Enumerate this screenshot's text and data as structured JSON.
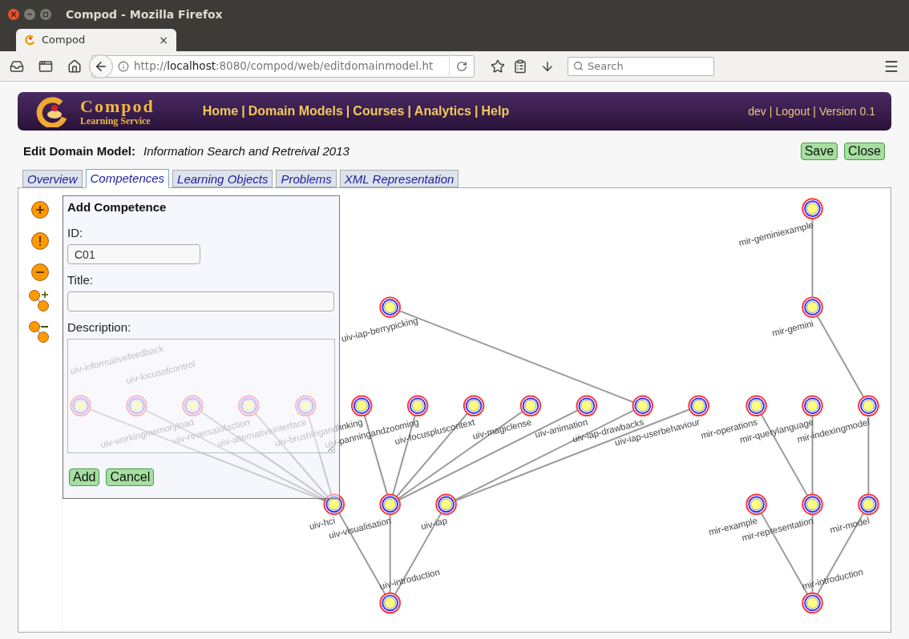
{
  "browser": {
    "window_title": "Compod - Mozilla Firefox",
    "tab": {
      "label": "Compod",
      "close": "×"
    },
    "url": {
      "scheme": "http://",
      "host": "localhost",
      "rest": ":8080/compod/web/editdomainmodel.ht"
    },
    "search": {
      "placeholder": "Search"
    }
  },
  "header": {
    "logo_title": "Compod",
    "logo_subtitle": "Learning Service",
    "separator": "|",
    "nav": [
      "Home",
      "Domain Models",
      "Courses",
      "Analytics",
      "Help"
    ],
    "account": [
      "dev",
      "Logout",
      "Version 0.1"
    ]
  },
  "edit": {
    "label": "Edit Domain Model:",
    "name": "Information Search and Retreival 2013",
    "buttons": [
      "Save",
      "Close"
    ]
  },
  "tabs": [
    {
      "label": "Overview",
      "selected": false
    },
    {
      "label": "Competences",
      "selected": true
    },
    {
      "label": "Learning Objects",
      "selected": false
    },
    {
      "label": "Problems",
      "selected": false
    },
    {
      "label": "XML Representation",
      "selected": false
    }
  ],
  "form": {
    "title": "Add Competence",
    "fields": [
      {
        "label": "ID:",
        "kind": "short",
        "value": "C01"
      },
      {
        "label": "Title:",
        "kind": "text"
      },
      {
        "label": "Description:",
        "kind": "textarea"
      }
    ],
    "buttons": [
      "Add",
      "Cancel"
    ]
  },
  "graph": {
    "nodes": [
      {
        "label": "mir-geminiexample"
      },
      {
        "label": "uiv-iap-berrypicking"
      },
      {
        "label": "mir-gemini"
      },
      {
        "label": "uiv-informativefeedback"
      },
      {
        "label": "uiv-locusofcontrol"
      },
      {
        "label": "uiv-workingmemoryload"
      },
      {
        "label": "uiv-reversalofaction"
      },
      {
        "label": "uiv-alternativeinterface"
      },
      {
        "label": "uiv-brushingandlinking"
      },
      {
        "label": "uiv-panningandzooming"
      },
      {
        "label": "uiv-focuspluscontext"
      },
      {
        "label": "uiv-magiclense"
      },
      {
        "label": "uiv-animation"
      },
      {
        "label": "uiv-iap-drawbacks"
      },
      {
        "label": "uiv-iap-userbehaviour"
      },
      {
        "label": "mir-operations"
      },
      {
        "label": "mir-querylanguage"
      },
      {
        "label": "mir-indexingmodel"
      },
      {
        "label": "uiv-hci"
      },
      {
        "label": "uiv-visualisation"
      },
      {
        "label": "uiv-iap"
      },
      {
        "label": "mir-example"
      },
      {
        "label": "mir-representation"
      },
      {
        "label": "mir-model"
      },
      {
        "label": "uiv-introduction"
      },
      {
        "label": "mir-introduction"
      }
    ]
  }
}
